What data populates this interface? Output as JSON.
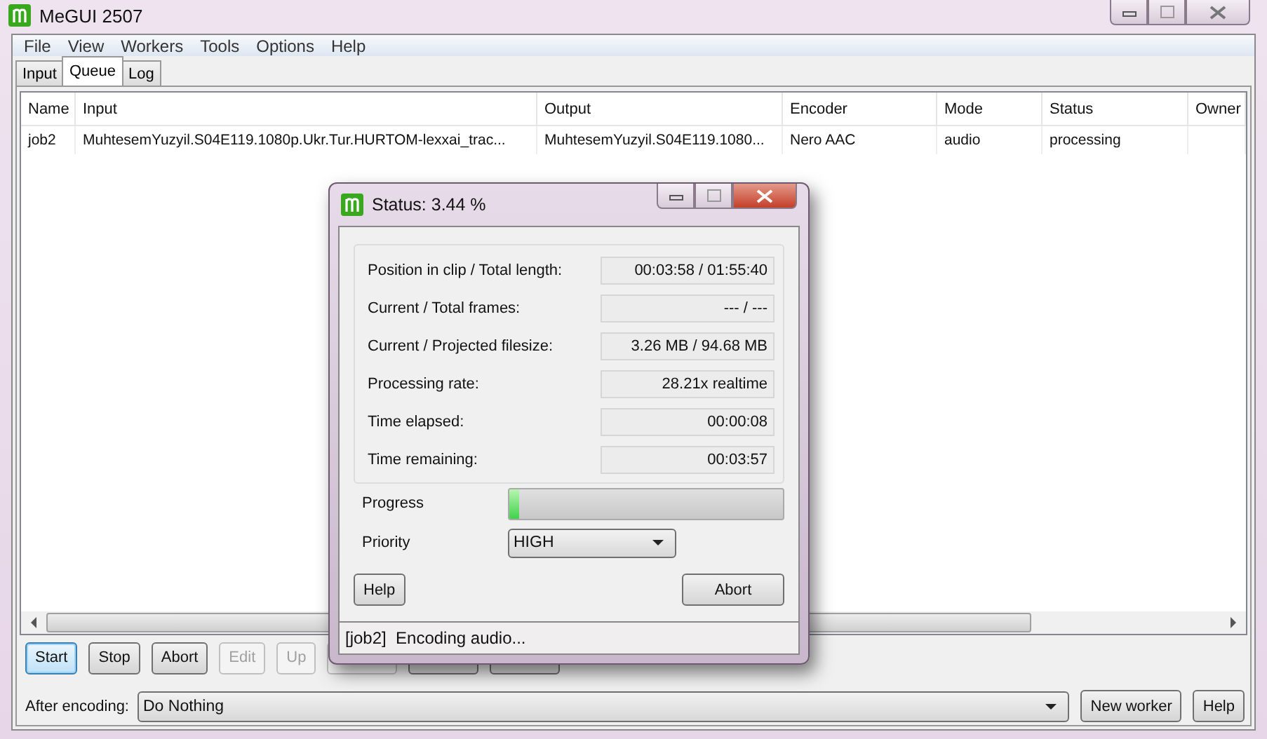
{
  "window": {
    "title": "MeGUI 2507"
  },
  "menu": [
    "File",
    "View",
    "Workers",
    "Tools",
    "Options",
    "Help"
  ],
  "tabs": [
    {
      "label": "Input",
      "selected": false
    },
    {
      "label": "Queue",
      "selected": true
    },
    {
      "label": "Log",
      "selected": false
    }
  ],
  "table": {
    "columns": [
      "Name",
      "Input",
      "Output",
      "Encoder",
      "Mode",
      "Status",
      "Owner"
    ],
    "rows": [
      {
        "cells": [
          "job2",
          "MuhtesemYuzyil.S04E119.1080p.Ukr.Tur.HURTOM-lexxai_trac...",
          "MuhtesemYuzyil.S04E119.1080...",
          "Nero AAC",
          "audio",
          "processing",
          ""
        ]
      }
    ]
  },
  "queue_buttons": [
    {
      "kind": "button",
      "label": "Start",
      "disabled": false,
      "focused": true
    },
    {
      "kind": "button",
      "label": "Stop",
      "disabled": false,
      "focused": false
    },
    {
      "kind": "button",
      "label": "Abort",
      "disabled": false,
      "focused": false
    },
    {
      "kind": "button",
      "label": "Edit",
      "disabled": true,
      "focused": false
    },
    {
      "kind": "button",
      "label": "Up",
      "disabled": true,
      "focused": false
    },
    {
      "kind": "covered",
      "disabled": true,
      "focused": false
    },
    {
      "kind": "covered",
      "disabled": false,
      "focused": false
    },
    {
      "kind": "covered",
      "disabled": false,
      "focused": false
    }
  ],
  "after_encoding": {
    "label": "After encoding:",
    "value": "Do Nothing"
  },
  "footer_buttons": [
    "New worker",
    "Help"
  ],
  "status_dialog": {
    "title": "Status: 3.44 %",
    "fields": [
      {
        "label": "Position in clip / Total length:",
        "value": "00:03:58 / 01:55:40"
      },
      {
        "label": "Current / Total frames:",
        "value": "--- / ---"
      },
      {
        "label": "Current / Projected filesize:",
        "value": "3.26 MB / 94.68 MB"
      },
      {
        "label": "Processing rate:",
        "value": "28.21x realtime"
      },
      {
        "label": "Time elapsed:",
        "value": "00:00:08"
      },
      {
        "label": "Time remaining:",
        "value": "00:03:57"
      }
    ],
    "progress": {
      "label": "Progress",
      "level": 0.0344
    },
    "priority": {
      "label": "Priority",
      "value": "HIGH"
    },
    "buttons": [
      "Help",
      "Abort"
    ],
    "status_bar": "[job2]  Encoding audio..."
  }
}
